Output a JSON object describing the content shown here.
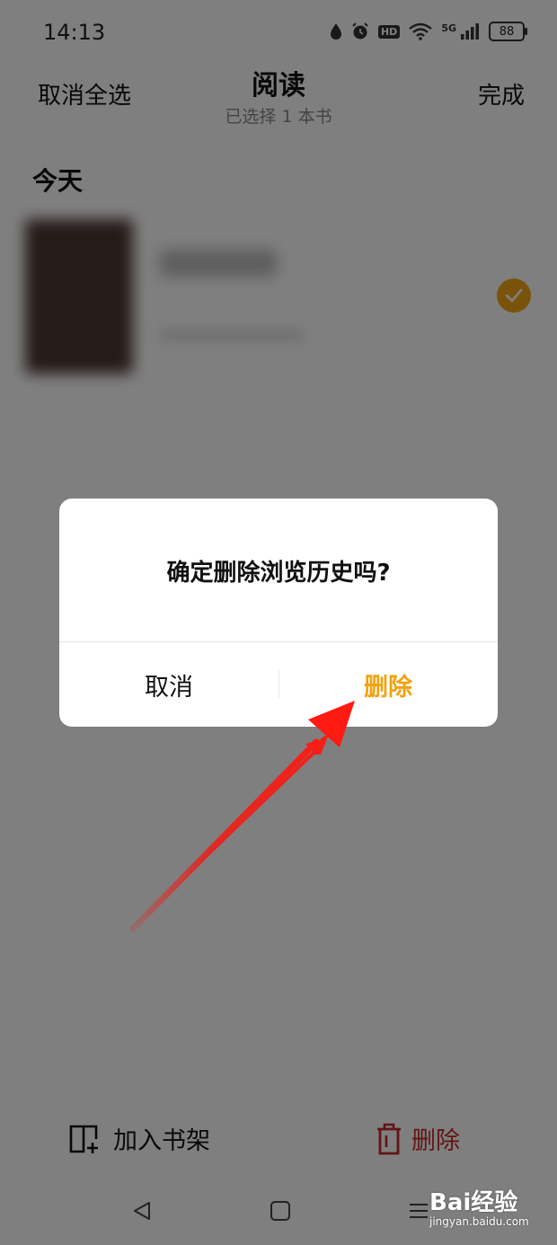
{
  "status_bar": {
    "time": "14:13",
    "hd": "HD",
    "network": "5G",
    "battery": "88"
  },
  "header": {
    "cancel_select_label": "取消全选",
    "title": "阅读",
    "subtitle": "已选择 1 本书",
    "done_label": "完成"
  },
  "section": {
    "title": "今天"
  },
  "bottom_bar": {
    "add_to_shelf_label": "加入书架",
    "delete_label": "删除"
  },
  "dialog": {
    "message": "确定删除浏览历史吗?",
    "cancel_label": "取消",
    "confirm_label": "删除"
  },
  "watermark": {
    "logo": "Bai经验",
    "url": "jingyan.baidu.com"
  },
  "colors": {
    "accent": "#f4a615",
    "dialog_confirm": "#f2a20e",
    "delete_red": "#c62828",
    "arrow": "#e8221b",
    "overlay": "rgba(0,0,0,0.5)"
  }
}
